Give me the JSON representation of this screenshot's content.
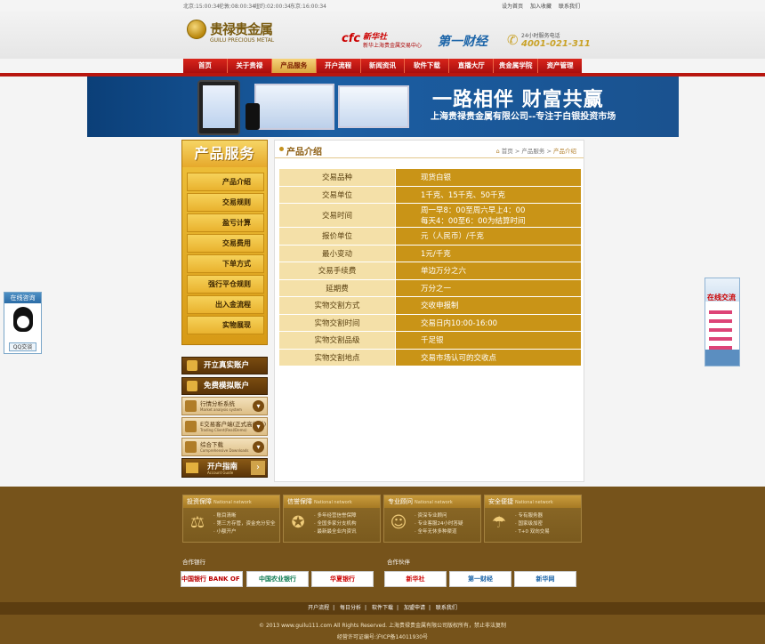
{
  "topbar": {
    "clocks": [
      "北京:15:00:34",
      "伦敦:08:00:34",
      "纽约:02:00:34",
      "东京:16:00:34"
    ],
    "links": [
      "设为首页",
      "加入收藏",
      "联系我们"
    ]
  },
  "logo": {
    "cn": "贵禄贵金属",
    "en": "GUILU PRECIOUS METAL"
  },
  "partners_header": {
    "p1_mark": "cfc",
    "p1_name": "新华社",
    "p1_sub": "新华上海贵金属交易中心",
    "p2": "第一财经"
  },
  "hotline": {
    "label": "24小时服务电话",
    "number": "4001-021-311"
  },
  "nav": [
    "首页",
    "关于贵禄",
    "产品服务",
    "开户流程",
    "新闻资讯",
    "软件下载",
    "直播大厅",
    "贵金属学院",
    "资产管理"
  ],
  "nav_active_index": 2,
  "banner": {
    "slogan": "一路相伴 财富共赢",
    "sub": "上海贵禄贵金属有限公司--专注于白银投资市场"
  },
  "qq_widget": {
    "title": "在线咨询",
    "button": "QQ交谈"
  },
  "online_widget": {
    "title": "在线交流"
  },
  "sidebar": {
    "title": "产品服务",
    "menu": [
      "产品介绍",
      "交易规则",
      "盈亏计算",
      "交易费用",
      "下单方式",
      "强行平仓规则",
      "出入金流程",
      "实物展现"
    ],
    "btn_real": "开立真实账户",
    "btn_demo": "免费模拟账户",
    "cards": [
      {
        "t1": "行情分析系统",
        "t2": "Market analysis system"
      },
      {
        "t1": "E交易客户端(正式高级版)",
        "t2": "Trading Client(Real/Demo)"
      },
      {
        "t1": "综合下载",
        "t2": "Comprehensive Downloads"
      }
    ],
    "guide": {
      "t1": "开户指南",
      "t2": "Account Guide"
    }
  },
  "content": {
    "title": "产品介绍",
    "breadcrumb": {
      "home": "首页",
      "sep": ">",
      "parent": "产品服务",
      "current": "产品介绍"
    },
    "rows": [
      {
        "k": "交易品种",
        "v": [
          "现货白银"
        ]
      },
      {
        "k": "交易单位",
        "v": [
          "1千克、15千克、50千克"
        ]
      },
      {
        "k": "交易时间",
        "v": [
          "周一早8：00至周六早上4：00",
          "每天4：00至6：00为结算时间"
        ]
      },
      {
        "k": "报价单位",
        "v": [
          "元（人民币）/千克"
        ]
      },
      {
        "k": "最小变动",
        "v": [
          "1元/千克"
        ]
      },
      {
        "k": "交易手续费",
        "v": [
          "单边万分之六"
        ]
      },
      {
        "k": "延期费",
        "v": [
          "万分之一"
        ]
      },
      {
        "k": "实物交割方式",
        "v": [
          "交收申报制"
        ]
      },
      {
        "k": "实物交割时间",
        "v": [
          "交易日内10:00-16:00"
        ]
      },
      {
        "k": "实物交割品级",
        "v": [
          "千足银"
        ]
      },
      {
        "k": "实物交割地点",
        "v": [
          "交易市场认可的交收点"
        ]
      }
    ]
  },
  "footer": {
    "boxes": [
      {
        "title": "投资保障",
        "en": "National network",
        "icon": "scales-icon",
        "items": [
          "账目清晰",
          "第三方存管，资金充分安全",
          "小额开户"
        ]
      },
      {
        "title": "信誉保障",
        "en": "National network",
        "icon": "medal-icon",
        "items": [
          "多年经营信誉保障",
          "全国多家分支机构",
          "最新最全业内资讯"
        ]
      },
      {
        "title": "专业顾问",
        "en": "National network",
        "icon": "advisor-icon",
        "items": [
          "资深专业顾问",
          "专业客服24小时答疑",
          "全年无休多种渠道"
        ]
      },
      {
        "title": "安全便捷",
        "en": "National network",
        "icon": "umbrella-icon",
        "items": [
          "专有服务器",
          "国家级加密",
          "T+0 双向交易"
        ]
      }
    ],
    "banks_label": "合作银行",
    "partners_label": "合作伙伴",
    "banks": [
      "中国银行 BANK OF CHINA",
      "中国农业银行",
      "华夏银行"
    ],
    "partners": [
      "新华社",
      "第一财经",
      "新华网"
    ],
    "links": [
      "开户流程",
      "每日分析",
      "软件下载",
      "加盟申请",
      "联系我们"
    ],
    "copyright": "© 2013 www.guilu111.com All Rights Reserved. 上海贵禄贵金属有限公司版权所有，禁止非法复制",
    "icp": "经营许可证编号:沪ICP备14011930号"
  }
}
